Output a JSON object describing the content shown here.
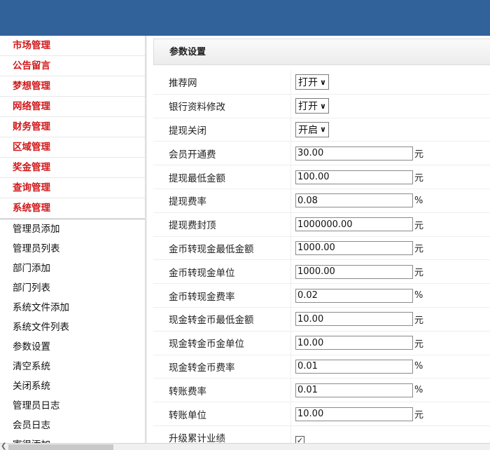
{
  "sidebar": {
    "categories": [
      "市场管理",
      "公告留言",
      "梦想管理",
      "网络管理",
      "财务管理",
      "区域管理",
      "奖金管理",
      "查询管理",
      "系统管理"
    ],
    "items": [
      "管理员添加",
      "管理员列表",
      "部门添加",
      "部门列表",
      "系统文件添加",
      "系统文件列表",
      "参数设置",
      "清空系统",
      "关闭系统",
      "管理员日志",
      "会员日志",
      "寄很添加"
    ]
  },
  "panel": {
    "title": "参数设置"
  },
  "rows": [
    {
      "label": "推荐网",
      "type": "select",
      "value": "打开"
    },
    {
      "label": "银行资料修改",
      "type": "select",
      "value": "打开"
    },
    {
      "label": "提现关闭",
      "type": "select",
      "value": "开启"
    },
    {
      "label": "会员开通费",
      "type": "input",
      "value": "30.00",
      "unit": "元"
    },
    {
      "label": "提现最低金额",
      "type": "input",
      "value": "100.00",
      "unit": "元"
    },
    {
      "label": "提现费率",
      "type": "input",
      "value": "0.08",
      "unit": "%"
    },
    {
      "label": "提现费封顶",
      "type": "input",
      "value": "1000000.00",
      "unit": "元"
    },
    {
      "label": "金币转现金最低金额",
      "type": "input",
      "value": "1000.00",
      "unit": "元"
    },
    {
      "label": "金币转现金单位",
      "type": "input",
      "value": "1000.00",
      "unit": "元"
    },
    {
      "label": "金币转现金费率",
      "type": "input",
      "value": "0.02",
      "unit": "%"
    },
    {
      "label": "现金转金币最低金额",
      "type": "input",
      "value": "10.00",
      "unit": "元"
    },
    {
      "label": "现金转金币金单位",
      "type": "input",
      "value": "10.00",
      "unit": "元"
    },
    {
      "label": "现金转金币费率",
      "type": "input",
      "value": "0.01",
      "unit": "%"
    },
    {
      "label": "转账费率",
      "type": "input",
      "value": "0.01",
      "unit": "%"
    },
    {
      "label": "转账单位",
      "type": "input",
      "value": "10.00",
      "unit": "元"
    },
    {
      "label": "升级累计业绩",
      "type": "checkbox",
      "checked": true
    }
  ],
  "colors": {
    "topbar": "#31629a",
    "category_text": "#d1191b"
  }
}
